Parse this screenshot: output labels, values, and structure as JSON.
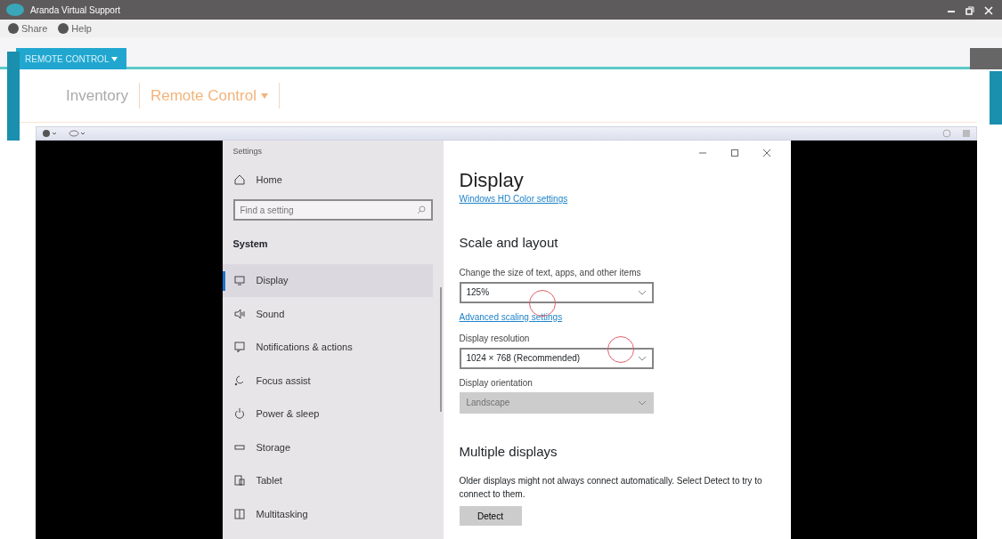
{
  "window": {
    "title": "Aranda Virtual Support"
  },
  "toolbar": [
    "Share",
    "Help"
  ],
  "session_tab": {
    "label": "REMOTE CONTROL"
  },
  "module_tabs": [
    {
      "label": "Inventory",
      "selected": false
    },
    {
      "label": "Remote Control",
      "selected": true
    }
  ],
  "settings": {
    "title": "Settings",
    "home": "Home",
    "search": {
      "placeholder": "Find a setting"
    },
    "section": "System",
    "nav": [
      {
        "label": "Display",
        "selected": true
      },
      {
        "label": "Sound",
        "selected": false
      },
      {
        "label": "Notifications & actions",
        "selected": false
      },
      {
        "label": "Focus assist",
        "selected": false
      },
      {
        "label": "Power & sleep",
        "selected": false
      },
      {
        "label": "Storage",
        "selected": false
      },
      {
        "label": "Tablet",
        "selected": false
      },
      {
        "label": "Multitasking",
        "selected": false
      }
    ],
    "page_title": "Display",
    "color_link": "Windows HD Color settings",
    "scale_heading": "Scale and layout",
    "fields": [
      {
        "label": "Change the size of text, apps, and other items",
        "value": "125%",
        "disabled": false
      },
      {
        "label": "Display resolution",
        "value": "1024 × 768 (Recommended)",
        "disabled": false
      },
      {
        "label": "Display orientation",
        "value": "Landscape",
        "disabled": true
      }
    ],
    "scaling_link": "Advanced scaling settings",
    "multi_heading": "Multiple displays",
    "multi_text": "Older displays might not always connect automatically. Select Detect to try to connect to them.",
    "detect_button": "Detect"
  }
}
